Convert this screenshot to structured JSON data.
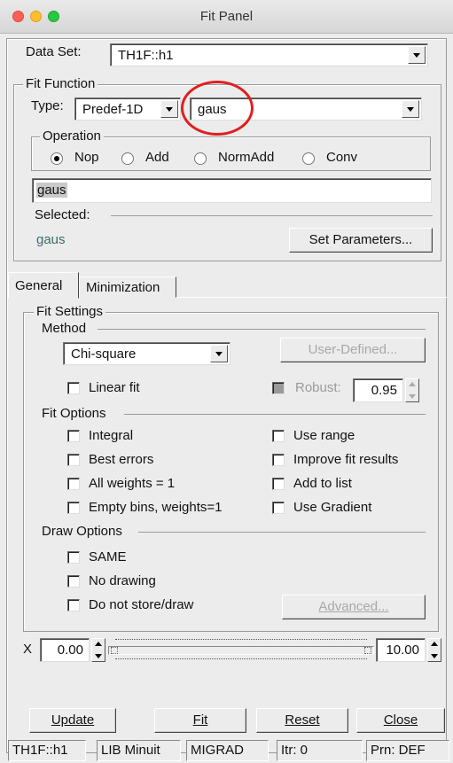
{
  "window": {
    "title": "Fit Panel"
  },
  "data_set": {
    "label": "Data Set:",
    "value": "TH1F::h1"
  },
  "fit_function": {
    "group_label": "Fit Function",
    "type_label": "Type:",
    "type_value": "Predef-1D",
    "function_value": "gaus",
    "operation": {
      "group_label": "Operation",
      "options": [
        "Nop",
        "Add",
        "NormAdd",
        "Conv"
      ],
      "selected": "Nop"
    },
    "formula_value": "gaus",
    "selected_label": "Selected:",
    "selected_value": "gaus",
    "set_parameters_label": "Set Parameters..."
  },
  "tabs": [
    "General",
    "Minimization"
  ],
  "general": {
    "fit_settings_label": "Fit Settings",
    "method": {
      "label": "Method",
      "value": "Chi-square",
      "user_defined_label": "User-Defined...",
      "linear_fit_label": "Linear fit",
      "robust_label": "Robust:",
      "robust_value": "0.95"
    },
    "fit_options": {
      "label": "Fit Options",
      "left": [
        "Integral",
        "Best errors",
        "All weights = 1",
        "Empty bins, weights=1"
      ],
      "right": [
        "Use range",
        "Improve fit results",
        "Add to list",
        "Use Gradient"
      ]
    },
    "draw_options": {
      "label": "Draw Options",
      "items": [
        "SAME",
        "No drawing",
        "Do not store/draw"
      ],
      "advanced_label": "Advanced..."
    }
  },
  "range": {
    "label": "X",
    "min": "0.00",
    "max": "10.00"
  },
  "buttons": {
    "update": "Update",
    "fit": "Fit",
    "reset": "Reset",
    "close": "Close"
  },
  "status_bar": [
    "TH1F::h1",
    "LIB Minuit",
    "MIGRAD",
    "Itr: 0",
    "Prn: DEF"
  ],
  "colors": {
    "selected_function": "#3d6b6b",
    "annotation_circle": "#e02020"
  }
}
